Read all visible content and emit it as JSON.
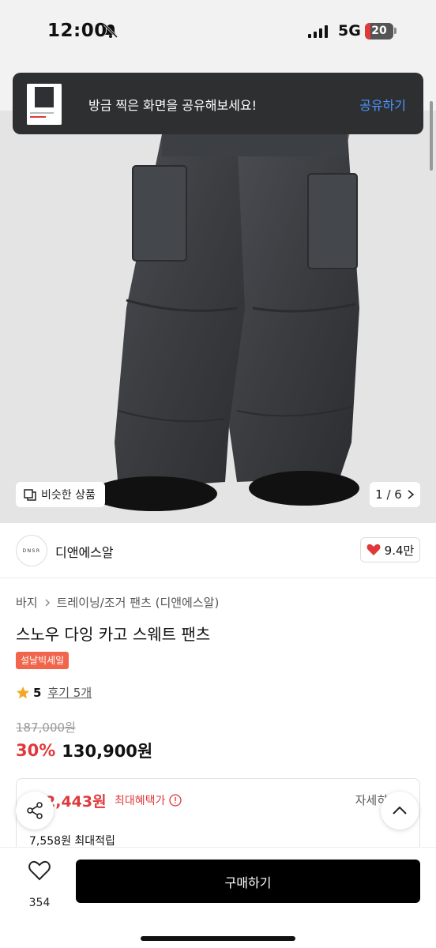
{
  "status_bar": {
    "time": "12:00",
    "network": "5G",
    "battery": "20",
    "battery_level": 0.2
  },
  "toast": {
    "message": "방금 찍은 화면을 공유해보세요!",
    "action": "공유하기"
  },
  "gallery": {
    "similar_label": "비슷한 상품",
    "counter": "1 / 6"
  },
  "brand": {
    "logo_text": "DNSR",
    "name": "디앤에스알",
    "likes": "9.4만"
  },
  "breadcrumb": [
    "바지",
    "트레이닝/조거 팬츠 (디앤에스알)"
  ],
  "product": {
    "title": "스노우 다잉 카고 스웨트 팬츠",
    "badge": "설날빅세일",
    "rating": "5",
    "reviews": "후기 5개",
    "original_price": "187,000원",
    "discount": "30%",
    "price": "130,900원"
  },
  "benefit": {
    "price": "2,443원",
    "label": "최대혜택가",
    "detail": "자세히",
    "points": "7,558원 최대적립"
  },
  "bottom_bar": {
    "wish_count": "354",
    "buy_label": "구매하기"
  },
  "colors": {
    "accent_red": "#e0393b",
    "link_blue": "#4b96ff",
    "badge_orange": "#f0654b"
  }
}
